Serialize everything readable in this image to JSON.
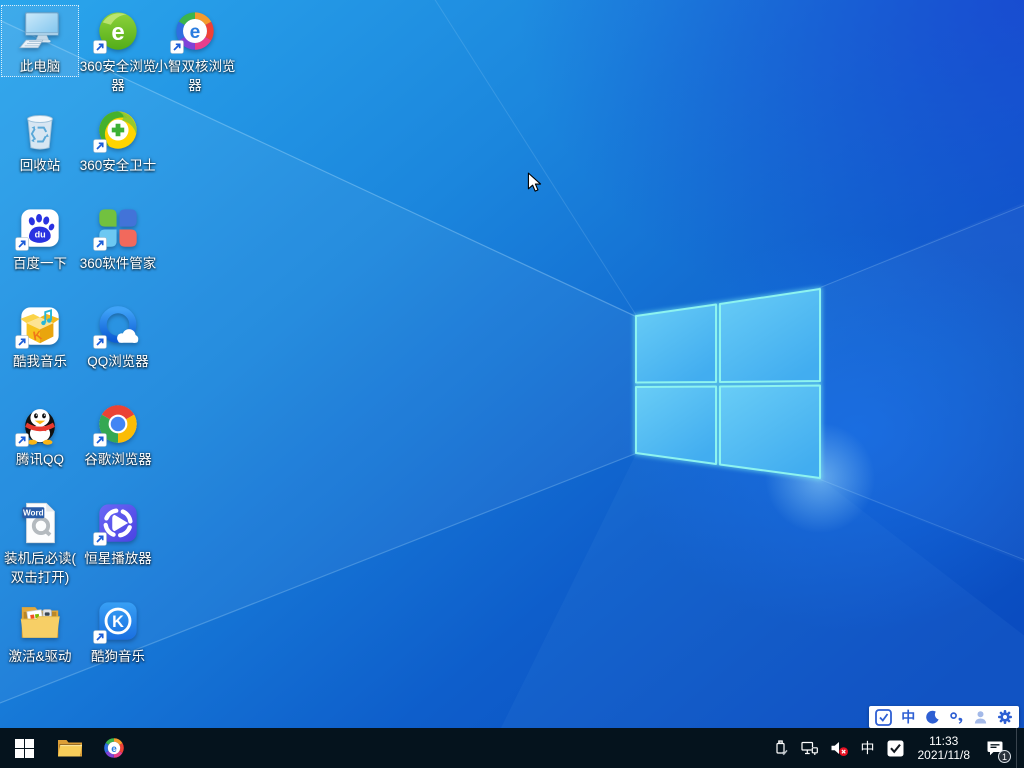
{
  "desktop": {
    "selected_icon": "this-pc",
    "icons": [
      {
        "id": "this-pc",
        "label": "此电脑",
        "shortcut": false,
        "selected": true
      },
      {
        "id": "browser-360",
        "label": "360安全浏览",
        "label2": "器",
        "shortcut": true,
        "glyph": "e"
      },
      {
        "id": "browser-xiaozhi",
        "label": "小智双核浏览",
        "label2": "器",
        "shortcut": true,
        "glyph": "e"
      },
      {
        "id": "recycle-bin",
        "label": "回收站",
        "shortcut": false
      },
      {
        "id": "safe-360",
        "label": "360安全卫士",
        "shortcut": true
      },
      {
        "id": "baidu",
        "label": "百度一下",
        "shortcut": true,
        "glyph": "du"
      },
      {
        "id": "manager-360",
        "label": "360软件管家",
        "shortcut": true
      },
      {
        "id": "kuwo-music",
        "label": "酷我音乐",
        "shortcut": true,
        "glyph": "K"
      },
      {
        "id": "qq-browser",
        "label": "QQ浏览器",
        "shortcut": true
      },
      {
        "id": "tencent-qq",
        "label": "腾讯QQ",
        "shortcut": true
      },
      {
        "id": "chrome",
        "label": "谷歌浏览器",
        "shortcut": true
      },
      {
        "id": "readme",
        "label": "装机后必读(",
        "label2": "双击打开)",
        "shortcut": false,
        "badge": "Word"
      },
      {
        "id": "star-player",
        "label": "恒星播放器",
        "shortcut": true
      },
      {
        "id": "activate-drivers",
        "label": "激活&驱动",
        "shortcut": false
      },
      {
        "id": "kugou-music",
        "label": "酷狗音乐",
        "shortcut": true,
        "glyph": "K"
      }
    ]
  },
  "taskbar": {
    "pinned": [
      "start",
      "file-explorer",
      "xiaozhi-browser"
    ],
    "tray_icons": [
      "usb-device",
      "wired-network",
      "volume-muted",
      "ime-chinese",
      "360-safety"
    ],
    "ime_indicator": "中",
    "clock": {
      "time": "11:33",
      "date": "2021/11/8"
    },
    "notification_badge": "1"
  },
  "ime_bar": {
    "mode": "中",
    "icons": [
      "ime-logo",
      "chinese-mode",
      "night-mode",
      "punctuation",
      "account",
      "settings"
    ]
  },
  "colors": {
    "wallpaper_light": "#2ba6ec",
    "wallpaper_mid": "#1b86dd",
    "wallpaper_deep": "#0d5ecb",
    "wallpaper_corner": "#1641c8",
    "logo_pane": "#54c0f1",
    "logo_edge": "#8df3f0",
    "taskbar_bg": "#05131d",
    "ime_blue": "#2e5fd3",
    "mute_red": "#e81123"
  }
}
